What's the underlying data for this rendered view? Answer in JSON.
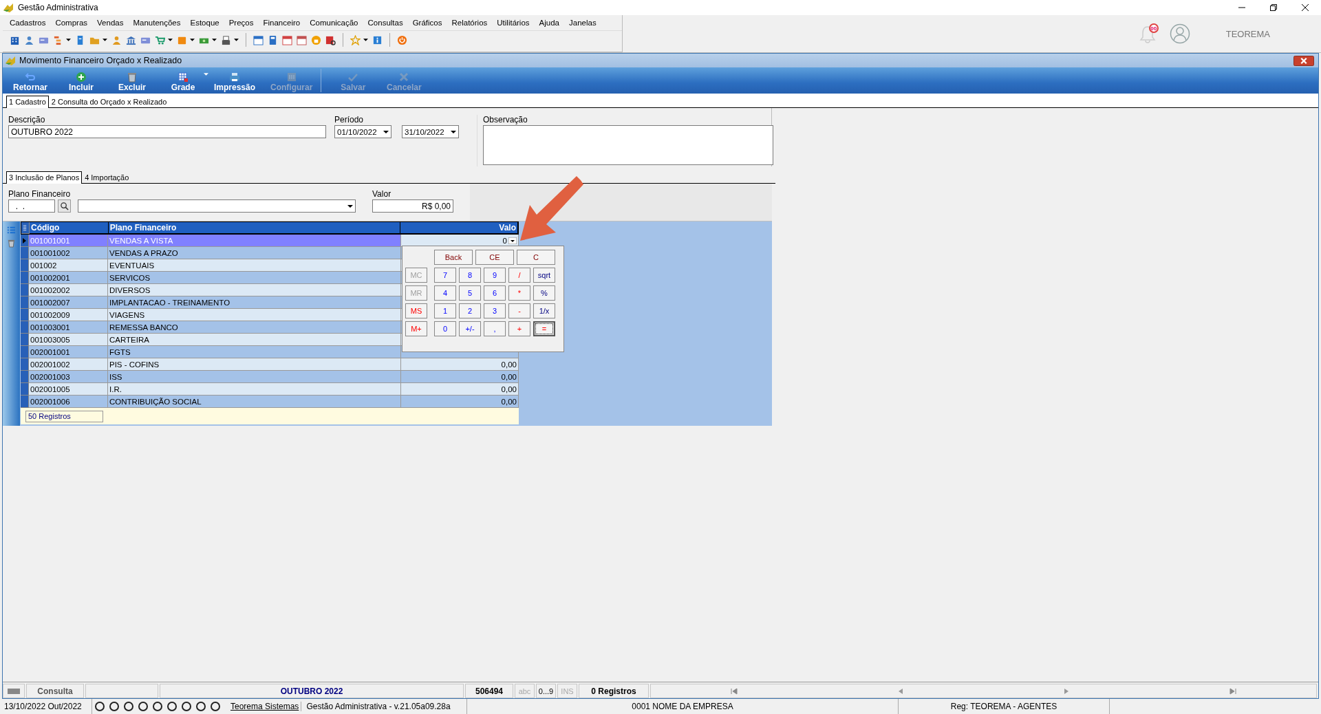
{
  "window": {
    "title": "Gestão Administrativa"
  },
  "menu": [
    "Cadastros",
    "Compras",
    "Vendas",
    "Manutenções",
    "Estoque",
    "Preços",
    "Financeiro",
    "Comunicação",
    "Consultas",
    "Gráficos",
    "Relatórios",
    "Utilitários",
    "Ajuda",
    "Janelas"
  ],
  "user": {
    "notifications": "00",
    "name": "TEOREMA"
  },
  "document": {
    "title": "Movimento Financeiro Orçado x Realizado",
    "toolbar": [
      {
        "label": "Retornar",
        "kind": "back",
        "disabled": false,
        "dropdown": false
      },
      {
        "label": "Incluir",
        "kind": "add",
        "disabled": false,
        "dropdown": false
      },
      {
        "label": "Excluir",
        "kind": "delete",
        "disabled": false,
        "dropdown": false
      },
      {
        "label": "Grade",
        "kind": "grid",
        "disabled": false,
        "dropdown": true
      },
      {
        "label": "Impressão",
        "kind": "print",
        "disabled": false,
        "dropdown": false
      },
      {
        "label": "Configurar",
        "kind": "config",
        "disabled": true,
        "dropdown": false
      },
      {
        "label": "Salvar",
        "kind": "save",
        "disabled": true,
        "dropdown": false
      },
      {
        "label": "Cancelar",
        "kind": "cancel",
        "disabled": true,
        "dropdown": false
      }
    ],
    "tabs": [
      {
        "label": "1 Cadastro",
        "selected": true
      },
      {
        "label": "2 Consulta do Orçado x Realizado",
        "selected": false
      }
    ],
    "form": {
      "descricao": {
        "label": "Descrição",
        "value": "OUTUBRO 2022"
      },
      "periodo": {
        "label": "Período",
        "start": "01/10/2022",
        "end": "31/10/2022"
      },
      "observacao": {
        "label": "Observação"
      }
    },
    "subtabs": [
      {
        "label": "3 Inclusão de Planos",
        "selected": true
      },
      {
        "label": "4 Importação",
        "selected": false
      }
    ],
    "plano": {
      "label": "Plano Financeiro",
      "code": "  .  .",
      "valor_label": "Valor",
      "valor": "R$ 0,00"
    },
    "grid": {
      "columns": [
        "Código",
        "Plano Financeiro",
        "Valo"
      ],
      "rows": [
        {
          "code": "001001001",
          "name": "VENDAS A VISTA",
          "value": "0",
          "selected": true
        },
        {
          "code": "001001002",
          "name": "VENDAS A PRAZO",
          "selected": false
        },
        {
          "code": "001002",
          "name": "EVENTUAIS",
          "selected": false
        },
        {
          "code": "001002001",
          "name": "SERVICOS",
          "selected": false
        },
        {
          "code": "001002002",
          "name": "DIVERSOS",
          "selected": false
        },
        {
          "code": "001002007",
          "name": "IMPLANTACAO - TREINAMENTO",
          "selected": false
        },
        {
          "code": "001002009",
          "name": "VIAGENS",
          "selected": false
        },
        {
          "code": "001003001",
          "name": "REMESSA BANCO",
          "selected": false
        },
        {
          "code": "001003005",
          "name": "CARTEIRA",
          "selected": false
        },
        {
          "code": "002001001",
          "name": "FGTS",
          "selected": false
        },
        {
          "code": "002001002",
          "name": "PIS - COFINS",
          "value": "0,00",
          "selected": false
        },
        {
          "code": "002001003",
          "name": "ISS",
          "value": "0,00",
          "selected": false
        },
        {
          "code": "002001005",
          "name": "I.R.",
          "value": "0,00",
          "selected": false
        },
        {
          "code": "002001006",
          "name": "CONTRIBUIÇÃO SOCIAL",
          "value": "0,00",
          "selected": false
        }
      ],
      "footer": "50 Registros"
    },
    "calculator": {
      "clear_keys": [
        {
          "label": "Back",
          "kind": "clear"
        },
        {
          "label": "CE",
          "kind": "clear"
        },
        {
          "label": "C",
          "kind": "clear"
        }
      ],
      "rows": [
        [
          {
            "label": "MC",
            "kind": "memory",
            "disabled": true
          },
          {
            "label": "7",
            "kind": "digit"
          },
          {
            "label": "8",
            "kind": "digit"
          },
          {
            "label": "9",
            "kind": "digit"
          },
          {
            "label": "/",
            "kind": "operator"
          },
          {
            "label": "sqrt",
            "kind": "function"
          }
        ],
        [
          {
            "label": "MR",
            "kind": "memory",
            "disabled": true
          },
          {
            "label": "4",
            "kind": "digit"
          },
          {
            "label": "5",
            "kind": "digit"
          },
          {
            "label": "6",
            "kind": "digit"
          },
          {
            "label": "*",
            "kind": "operator"
          },
          {
            "label": "%",
            "kind": "function"
          }
        ],
        [
          {
            "label": "MS",
            "kind": "memory",
            "disabled": false
          },
          {
            "label": "1",
            "kind": "digit"
          },
          {
            "label": "2",
            "kind": "digit"
          },
          {
            "label": "3",
            "kind": "digit"
          },
          {
            "label": "-",
            "kind": "operator"
          },
          {
            "label": "1/x",
            "kind": "function"
          }
        ],
        [
          {
            "label": "M+",
            "kind": "memory",
            "disabled": false
          },
          {
            "label": "0",
            "kind": "digit"
          },
          {
            "label": "+/-",
            "kind": "digit"
          },
          {
            "label": ",",
            "kind": "digit"
          },
          {
            "label": "+",
            "kind": "operator"
          },
          {
            "label": "=",
            "kind": "equals"
          }
        ]
      ]
    },
    "status_bar": [
      {
        "text": "Consulta",
        "kind": "mode",
        "disabled": false
      },
      {
        "text": "OUTUBRO 2022",
        "kind": "title",
        "disabled": false
      },
      {
        "text": "506494",
        "kind": "code",
        "disabled": false
      },
      {
        "text": "abc",
        "kind": "key",
        "disabled": true
      },
      {
        "text": "0...9",
        "kind": "key",
        "disabled": false
      },
      {
        "text": "INS",
        "kind": "key",
        "disabled": true
      },
      {
        "text": "0 Registros",
        "kind": "count",
        "disabled": false
      }
    ]
  },
  "footer": {
    "date": "13/10/2022 Out/2022",
    "link": "Teorema Sistemas",
    "version": "Gestão Administrativa - v.21.05a09.28a",
    "company": "0001 NOME DA EMPRESA",
    "registration": "Reg: TEOREMA - AGENTES"
  }
}
